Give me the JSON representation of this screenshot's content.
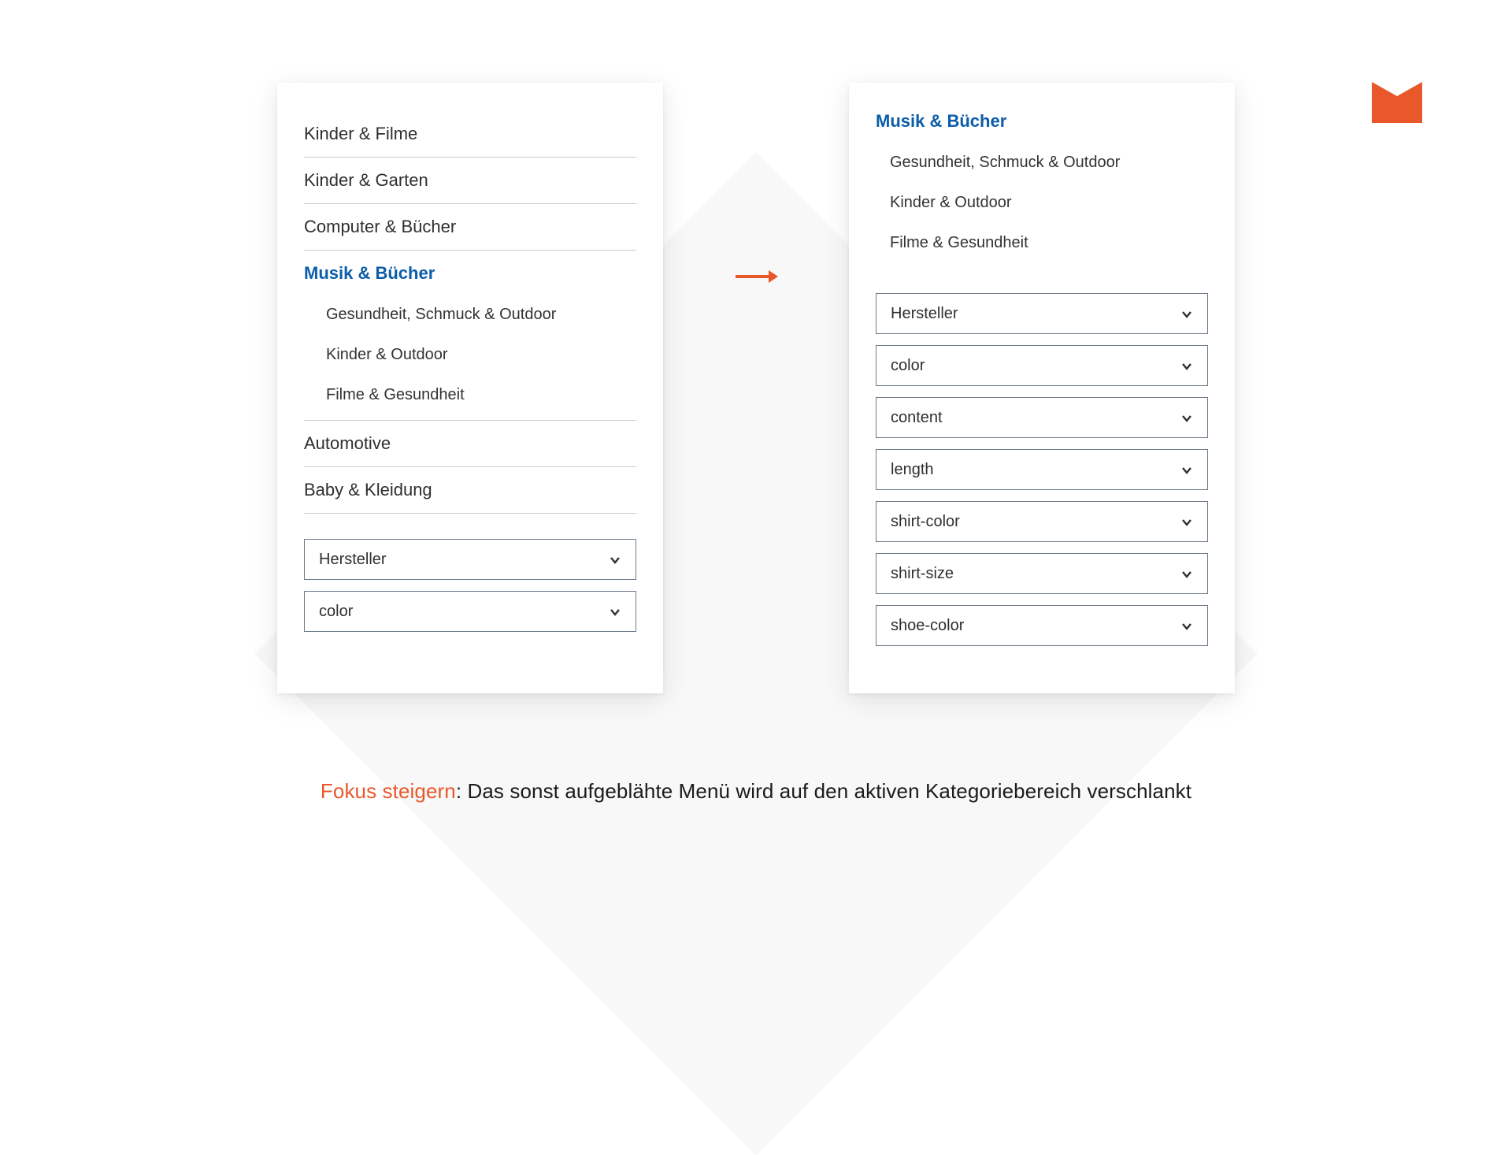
{
  "logo": {
    "color": "#e8582a"
  },
  "left_panel": {
    "categories": [
      {
        "label": "Kinder & Filme",
        "active": false
      },
      {
        "label": "Kinder & Garten",
        "active": false
      },
      {
        "label": "Computer & Bücher",
        "active": false
      },
      {
        "label": "Musik & Bücher",
        "active": true,
        "subcategories": [
          "Gesundheit, Schmuck & Outdoor",
          "Kinder & Outdoor",
          "Filme & Gesundheit"
        ]
      },
      {
        "label": "Automotive",
        "active": false
      },
      {
        "label": "Baby & Kleidung",
        "active": false
      }
    ],
    "filters": [
      {
        "label": "Hersteller"
      },
      {
        "label": "color"
      }
    ]
  },
  "right_panel": {
    "heading": "Musik & Bücher",
    "subcategories": [
      "Gesundheit, Schmuck & Outdoor",
      "Kinder & Outdoor",
      "Filme & Gesundheit"
    ],
    "filters": [
      {
        "label": "Hersteller"
      },
      {
        "label": "color"
      },
      {
        "label": "content"
      },
      {
        "label": "length"
      },
      {
        "label": "shirt-color"
      },
      {
        "label": "shirt-size"
      },
      {
        "label": "shoe-color"
      }
    ]
  },
  "caption": {
    "lead": "Fokus steigern",
    "rest": ": Das sonst aufgeblähte Menü wird auf den aktiven Kategoriebereich verschlankt"
  }
}
